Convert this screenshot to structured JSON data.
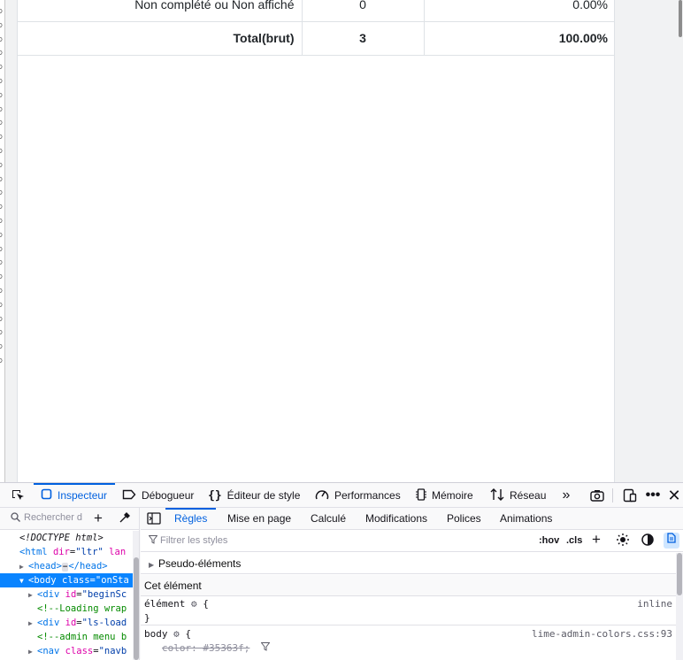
{
  "page": {
    "table_rows": [
      {
        "label": "Non complété ou Non affiché",
        "count": "0",
        "percent": "0.00%"
      },
      {
        "label": "Total(brut)",
        "count": "3",
        "percent": "100.00%"
      }
    ]
  },
  "devtools": {
    "tools": {
      "inspector": "Inspecteur",
      "debugger": "Débogueur",
      "style_editor": "Éditeur de style",
      "performance": "Performances",
      "memory": "Mémoire",
      "network": "Réseau"
    },
    "markup": {
      "search_placeholder": "Rechercher d",
      "lines": {
        "doctype": "<!DOCTYPE html>",
        "html_tag": "<html",
        "html_dir_attr": "dir",
        "html_dir_val": "\"ltr\"",
        "html_lang_attr": "lan",
        "head_open": "<head>",
        "head_ellipsis": "⋯",
        "head_close": "</head>",
        "body_tag": "<body",
        "body_class_attr": "class",
        "body_class_val": "\"onSta",
        "div1_tag": "<div",
        "div1_attr": "id",
        "div1_val": "\"beginSc",
        "comment1": "<!--Loading wrap",
        "div2_tag": "<div",
        "div2_attr": "id",
        "div2_val": "\"ls-load",
        "comment2": "<!--admin menu b",
        "nav_tag": "<nav",
        "nav_attr": "class",
        "nav_val": "\"navb"
      }
    },
    "rules_tabs": {
      "rules": "Règles",
      "layout": "Mise en page",
      "computed": "Calculé",
      "changes": "Modifications",
      "fonts": "Polices",
      "animations": "Animations"
    },
    "filter_placeholder": "Filtrer les styles",
    "hov": ":hov",
    "cls": ".cls",
    "pseudo_elements": "Pseudo-éléments",
    "this_element": "Cet élément",
    "rule_element": {
      "selector": "élément",
      "brace_open": "{",
      "brace_close": "}",
      "source": "inline"
    },
    "rule_body": {
      "selector": "body",
      "brace_open": "{",
      "source": "lime-admin-colors.css:93",
      "declaration": "color: #35363f;"
    }
  },
  "colors": {
    "accent": "#0060df",
    "selection": "#0a84ff"
  },
  "icons": {
    "picker": "element-picker-icon",
    "inspector": "inspector-icon",
    "debugger": "debugger-icon",
    "style_editor": "braces-icon",
    "performance": "gauge-icon",
    "memory": "memory-icon",
    "network": "network-arrows-icon",
    "overflow": "chevron-double-right-icon",
    "screenshot": "camera-icon",
    "responsive": "responsive-design-icon",
    "more": "more-dots-icon",
    "close": "close-icon"
  }
}
